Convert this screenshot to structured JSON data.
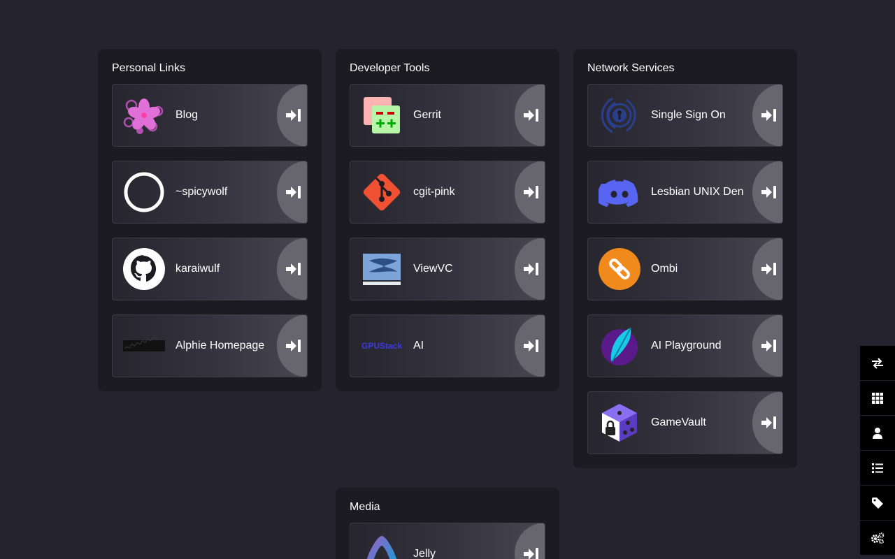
{
  "groups": [
    {
      "title": "Personal Links",
      "items": [
        {
          "label": "Blog",
          "icon": "cherry-blossom-icon"
        },
        {
          "label": "~spicywolf",
          "icon": "circle-ring-icon"
        },
        {
          "label": "karaiwulf",
          "icon": "github-icon"
        },
        {
          "label": "Alphie Homepage",
          "icon": "alphie-banner-icon"
        }
      ]
    },
    {
      "title": "Developer Tools",
      "items": [
        {
          "label": "Gerrit",
          "icon": "gerrit-icon"
        },
        {
          "label": "cgit-pink",
          "icon": "git-icon"
        },
        {
          "label": "ViewVC",
          "icon": "subversion-icon"
        },
        {
          "label": "AI",
          "icon": "gpustack-icon",
          "icon_text": "GPUStack"
        }
      ]
    },
    {
      "title": "Network Services",
      "items": [
        {
          "label": "Single Sign On",
          "icon": "sso-keyhole-icon"
        },
        {
          "label": "Lesbian UNIX Den",
          "icon": "discord-icon"
        },
        {
          "label": "Ombi",
          "icon": "ombi-link-icon"
        },
        {
          "label": "AI Playground",
          "icon": "feather-icon"
        },
        {
          "label": "GameVault",
          "icon": "locked-dice-icon"
        }
      ]
    },
    {
      "title": "Media",
      "items": [
        {
          "label": "Jelly",
          "icon": "jellyfin-icon"
        }
      ]
    }
  ],
  "launch_icon": "sign-in-arrow-icon",
  "sidebar": [
    {
      "icon": "swap-arrows-icon"
    },
    {
      "icon": "grid-icon"
    },
    {
      "icon": "user-icon"
    },
    {
      "icon": "list-icon"
    },
    {
      "icon": "tag-icon"
    },
    {
      "icon": "gears-icon"
    }
  ],
  "colors": {
    "background": "#25232f",
    "group_background": "#1c1b22",
    "launch_button": "#67656e",
    "discord": "#5865f2",
    "git": "#f05133",
    "ombi": "#f08a1c"
  }
}
